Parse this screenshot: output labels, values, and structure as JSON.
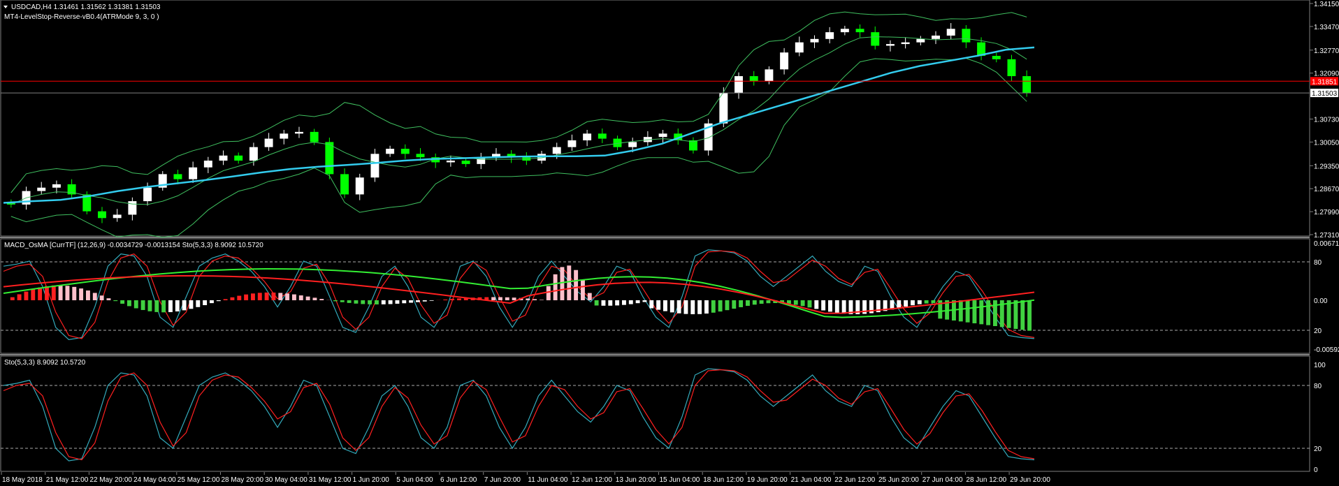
{
  "main_panel": {
    "title": "USDCAD,H4  1.31461 1.31562 1.31381 1.31503",
    "indicator": "MT4-LevelStop-Reverse-vB0.4(ATRMode 9, 3, 0 )",
    "collapse_icon": "triangle-down-icon",
    "price_ticks": [
      "1.34150",
      "1.33470",
      "1.32770",
      "1.32090",
      "1.31503",
      "1.30730",
      "1.30050",
      "1.29350",
      "1.28670",
      "1.27990",
      "1.27310"
    ],
    "red_line_price": 1.3185,
    "red_line_label": "1.31851",
    "bid_price": 1.31503,
    "bid_label": "1.31503",
    "colors": {
      "bull_candle": "#ffffff",
      "bear_candle": "#00ff00",
      "bands": "#3fbf5f",
      "ma": "#33ccee",
      "red_line": "#ff0000",
      "bid_line": "#808080"
    }
  },
  "macd_panel": {
    "title": "MACD_OsMA [CurrTF] (12,26,9) -0.0034729 -0.0013154  Sto(5,3,3) 8.9092 10.5720",
    "ticks": [
      "0.006716",
      "80",
      "0.00",
      "20",
      "-0.005926"
    ]
  },
  "sto_panel": {
    "title": "Sto(5,3,3) 8.9092 10.5720",
    "ticks": [
      "100",
      "80",
      "20",
      "0"
    ]
  },
  "x_ticks": [
    "18 May 2018",
    "21 May 12:00",
    "22 May 20:00",
    "24 May 04:00",
    "25 May 12:00",
    "28 May 20:00",
    "30 May 04:00",
    "31 May 12:00",
    "1 Jun 20:00",
    "5 Jun 04:00",
    "6 Jun 12:00",
    "7 Jun 20:00",
    "11 Jun 04:00",
    "12 Jun 12:00",
    "13 Jun 20:00",
    "15 Jun 04:00",
    "18 Jun 12:00",
    "19 Jun 20:00",
    "21 Jun 04:00",
    "22 Jun 12:00",
    "25 Jun 20:00",
    "27 Jun 04:00",
    "28 Jun 12:00",
    "29 Jun 20:00"
  ],
  "chart_data": {
    "type": "line",
    "x_axis": "time (H4 bars)",
    "close_prices": [
      1.282,
      1.286,
      1.287,
      1.288,
      1.285,
      1.28,
      1.278,
      1.279,
      1.283,
      1.287,
      1.291,
      1.2895,
      1.293,
      1.295,
      1.2965,
      1.295,
      1.299,
      1.3015,
      1.303,
      1.3035,
      1.3005,
      1.291,
      1.285,
      1.29,
      1.297,
      1.2985,
      1.297,
      1.296,
      1.2945,
      1.295,
      1.294,
      1.296,
      1.297,
      1.296,
      1.295,
      1.297,
      1.299,
      1.301,
      1.303,
      1.3015,
      1.299,
      1.3005,
      1.302,
      1.303,
      1.301,
      1.298,
      1.306,
      1.315,
      1.32,
      1.3185,
      1.322,
      1.327,
      1.33,
      1.331,
      1.333,
      1.334,
      1.333,
      1.329,
      1.3295,
      1.33,
      1.331,
      1.332,
      1.334,
      1.33,
      1.326,
      1.325,
      1.32,
      1.315
    ],
    "ma_values": [
      1.2825,
      1.283,
      1.2834,
      1.2845,
      1.286,
      1.2872,
      1.2882,
      1.2892,
      1.2903,
      1.2915,
      1.2925,
      1.2932,
      1.2937,
      1.2943,
      1.295,
      1.2955,
      1.2957,
      1.296,
      1.2962,
      1.2963,
      1.2963,
      1.2965,
      1.298,
      1.3,
      1.303,
      1.306,
      1.3085,
      1.311,
      1.3135,
      1.316,
      1.3185,
      1.321,
      1.323,
      1.3245,
      1.326,
      1.3278,
      1.3285
    ],
    "red_line": 1.3185,
    "bid": 1.31503,
    "ylim": [
      1.2731,
      1.3415
    ],
    "macd_range": [
      -0.005926,
      0.006716
    ],
    "sto_levels": [
      20,
      80
    ],
    "stochastic_main": [
      80,
      82,
      85,
      60,
      20,
      8,
      10,
      40,
      80,
      92,
      90,
      70,
      30,
      20,
      50,
      80,
      88,
      92,
      85,
      75,
      60,
      40,
      60,
      85,
      80,
      50,
      20,
      15,
      40,
      70,
      80,
      60,
      30,
      20,
      40,
      80,
      85,
      70,
      40,
      20,
      40,
      70,
      85,
      70,
      55,
      45,
      60,
      80,
      75,
      50,
      30,
      20,
      50,
      90,
      96,
      95,
      93,
      85,
      70,
      60,
      70,
      80,
      90,
      75,
      65,
      60,
      80,
      75,
      50,
      30,
      20,
      40,
      60,
      75,
      70,
      50,
      30,
      12,
      10,
      9
    ],
    "stochastic_signal": [
      75,
      80,
      82,
      70,
      35,
      12,
      9,
      25,
      65,
      88,
      92,
      80,
      45,
      22,
      35,
      70,
      85,
      90,
      88,
      78,
      65,
      48,
      55,
      78,
      82,
      62,
      30,
      18,
      30,
      60,
      78,
      68,
      42,
      24,
      32,
      68,
      84,
      76,
      50,
      26,
      32,
      60,
      80,
      76,
      60,
      48,
      54,
      74,
      77,
      58,
      38,
      24,
      40,
      80,
      94,
      95,
      94,
      88,
      75,
      64,
      66,
      76,
      86,
      80,
      68,
      62,
      74,
      77,
      58,
      38,
      24,
      34,
      54,
      70,
      72,
      56,
      36,
      18,
      12,
      10
    ]
  }
}
